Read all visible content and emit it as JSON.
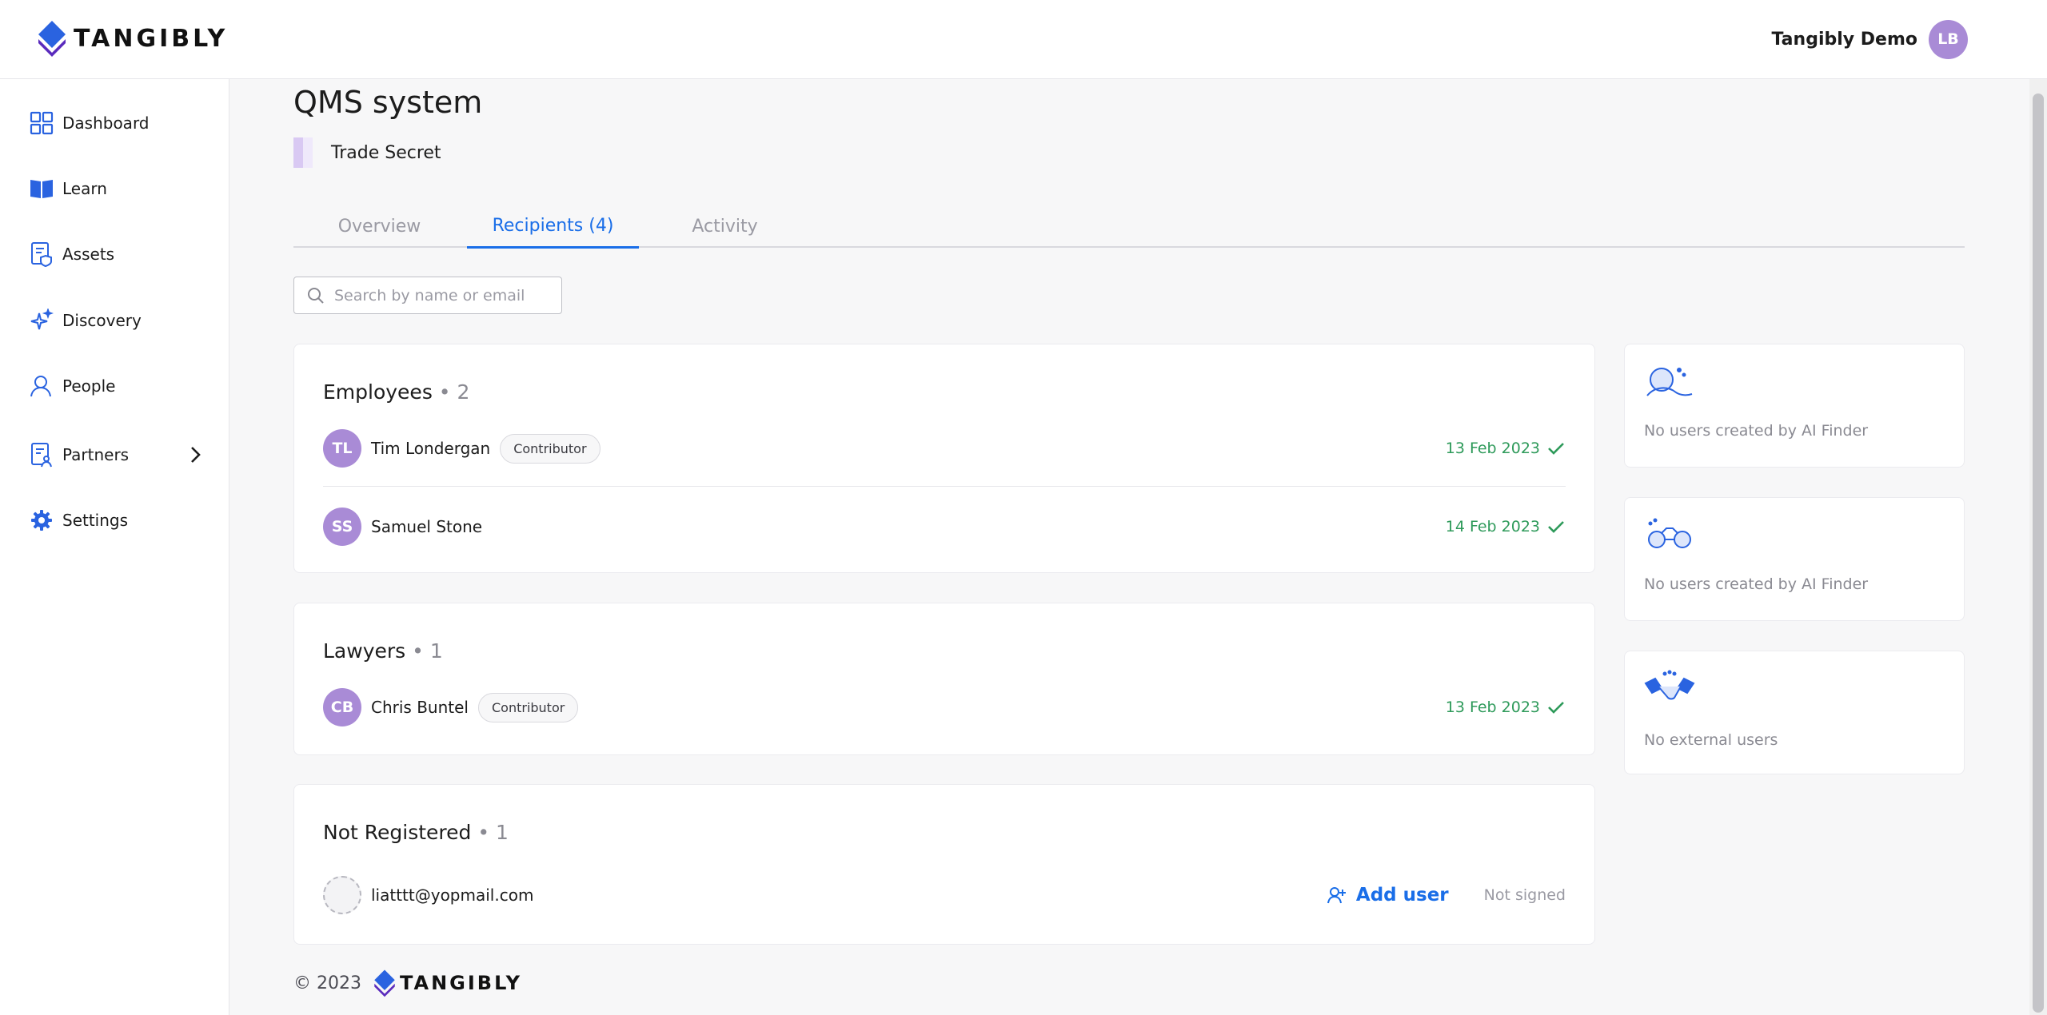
{
  "header": {
    "logo_text": "TANGIBLY",
    "user_name": "Tangibly Demo",
    "user_initials": "LB"
  },
  "sidebar": {
    "items": [
      {
        "label": "Dashboard",
        "icon": "dashboard-icon"
      },
      {
        "label": "Learn",
        "icon": "book-icon"
      },
      {
        "label": "Assets",
        "icon": "assets-icon"
      },
      {
        "label": "Discovery",
        "icon": "sparkle-icon"
      },
      {
        "label": "People",
        "icon": "person-icon"
      },
      {
        "label": "Partners",
        "icon": "partners-icon"
      },
      {
        "label": "Settings",
        "icon": "gear-icon"
      }
    ]
  },
  "asset": {
    "title": "QMS system",
    "type": "Trade Secret"
  },
  "tabs": [
    {
      "label": "Overview",
      "active": false
    },
    {
      "label": "Recipients (4)",
      "active": true
    },
    {
      "label": "Activity",
      "active": false
    }
  ],
  "search": {
    "placeholder": "Search by name or email"
  },
  "groups": {
    "employees": {
      "title": "Employees",
      "count": "• 2",
      "rows": [
        {
          "initials": "TL",
          "name": "Tim Londergan",
          "badge": "Contributor",
          "date": "13 Feb 2023"
        },
        {
          "initials": "SS",
          "name": "Samuel Stone",
          "badge": "",
          "date": "14 Feb 2023"
        }
      ]
    },
    "lawyers": {
      "title": "Lawyers",
      "count": "• 1",
      "rows": [
        {
          "initials": "CB",
          "name": "Chris Buntel",
          "badge": "Contributor",
          "date": "13 Feb 2023"
        }
      ]
    },
    "not_registered": {
      "title": "Not Registered",
      "count": "• 1",
      "rows": [
        {
          "email": "liatttt@yopmail.com",
          "action": "Add user",
          "status": "Not signed"
        }
      ]
    }
  },
  "side_cards": [
    {
      "text": "No users created by AI Finder",
      "icon": "ai-finder-icon"
    },
    {
      "text": "No users created by AI Finder",
      "icon": "binoculars-icon"
    },
    {
      "text": "No external users",
      "icon": "handshake-icon"
    }
  ],
  "footer": {
    "copyright": "© 2023",
    "logo_text": "TANGIBLY"
  },
  "colors": {
    "accent": "#1a6ee8",
    "avatar": "#a98bd6",
    "signed": "#2e9a5a"
  }
}
